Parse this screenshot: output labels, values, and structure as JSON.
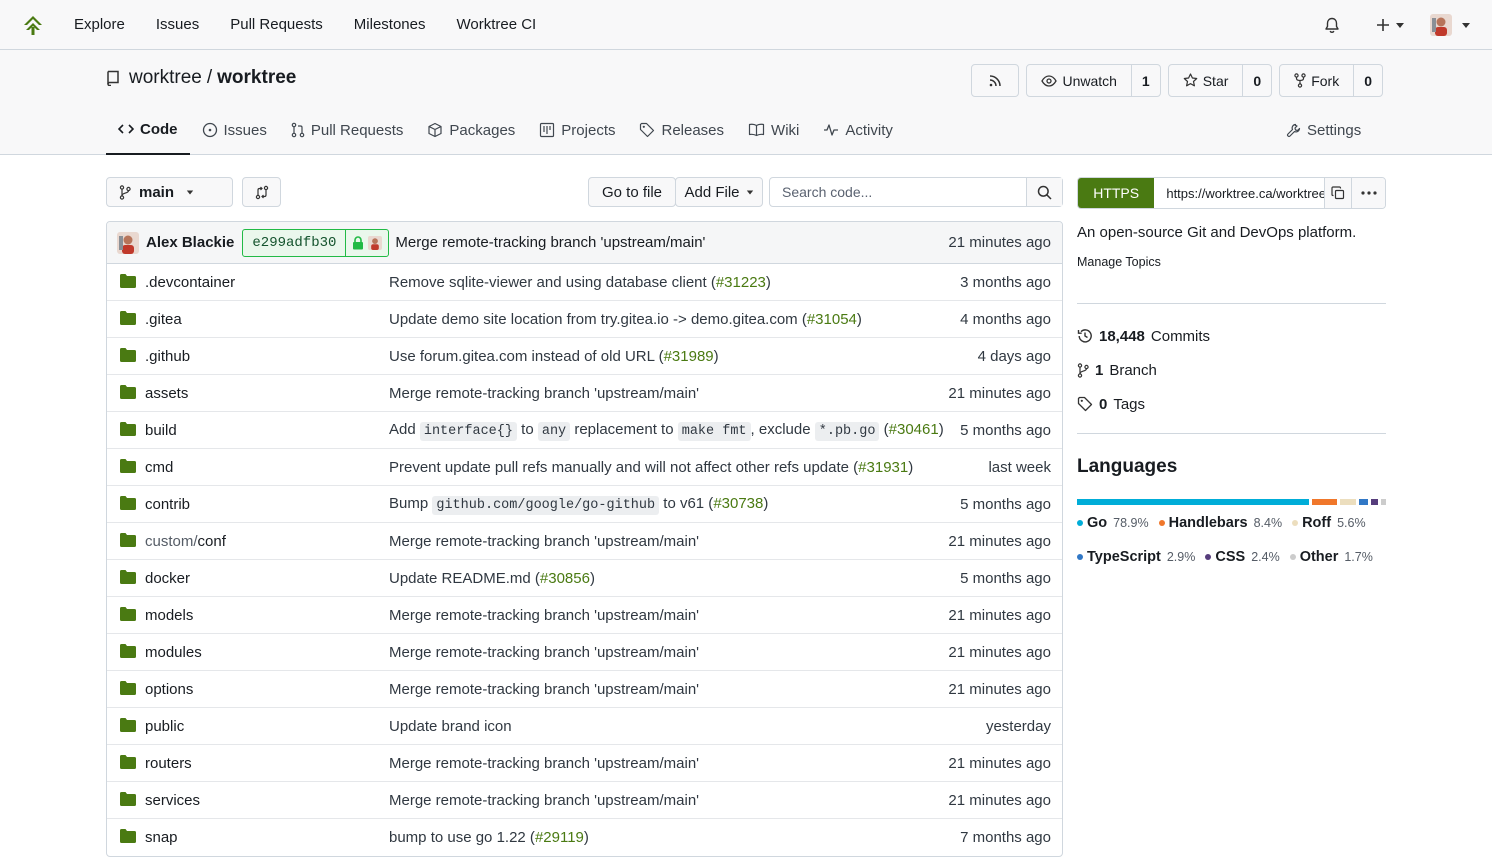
{
  "nav": {
    "items": [
      "Explore",
      "Issues",
      "Pull Requests",
      "Milestones",
      "Worktree CI"
    ]
  },
  "repo": {
    "owner": "worktree",
    "separator": "/",
    "name": "worktree",
    "watch_label": "Unwatch",
    "watch_count": "1",
    "star_label": "Star",
    "star_count": "0",
    "fork_label": "Fork",
    "fork_count": "0"
  },
  "tabs": [
    {
      "label": "Code",
      "icon": "code-icon"
    },
    {
      "label": "Issues",
      "icon": "issue-icon"
    },
    {
      "label": "Pull Requests",
      "icon": "pull-request-icon"
    },
    {
      "label": "Packages",
      "icon": "package-icon"
    },
    {
      "label": "Projects",
      "icon": "project-icon"
    },
    {
      "label": "Releases",
      "icon": "tag-icon"
    },
    {
      "label": "Wiki",
      "icon": "book-icon"
    },
    {
      "label": "Activity",
      "icon": "pulse-icon"
    }
  ],
  "settings_label": "Settings",
  "toolbar": {
    "branch": "main",
    "goto_file": "Go to file",
    "add_file": "Add File",
    "search_placeholder": "Search code..."
  },
  "latest_commit": {
    "author": "Alex Blackie",
    "sha": "e299adfb30",
    "message": "Merge remote-tracking branch 'upstream/main'",
    "time": "21 minutes ago"
  },
  "files": [
    {
      "name": ".devcontainer",
      "msg": [
        {
          "t": "Remove sqlite-viewer and using database client ("
        },
        {
          "t": "#31223",
          "k": "pr"
        },
        {
          "t": ")"
        }
      ],
      "time": "3 months ago"
    },
    {
      "name": ".gitea",
      "msg": [
        {
          "t": "Update demo site location from try.gitea.io -> demo.gitea.com ("
        },
        {
          "t": "#31054",
          "k": "pr"
        },
        {
          "t": ")"
        }
      ],
      "time": "4 months ago"
    },
    {
      "name": ".github",
      "msg": [
        {
          "t": "Use forum.gitea.com instead of old URL ("
        },
        {
          "t": "#31989",
          "k": "pr"
        },
        {
          "t": ")"
        }
      ],
      "time": "4 days ago"
    },
    {
      "name": "assets",
      "msg": [
        {
          "t": "Merge remote-tracking branch 'upstream/main'"
        }
      ],
      "time": "21 minutes ago"
    },
    {
      "name": "build",
      "msg": [
        {
          "t": "Add "
        },
        {
          "t": "interface{}",
          "k": "code"
        },
        {
          "t": " to "
        },
        {
          "t": "any",
          "k": "code"
        },
        {
          "t": " replacement to "
        },
        {
          "t": "make fmt",
          "k": "code"
        },
        {
          "t": ", exclude "
        },
        {
          "t": "*.pb.go",
          "k": "code"
        },
        {
          "t": " ("
        },
        {
          "t": "#30461",
          "k": "pr"
        },
        {
          "t": ")"
        }
      ],
      "time": "5 months ago"
    },
    {
      "name": "cmd",
      "msg": [
        {
          "t": "Prevent update pull refs manually and will not affect other refs update ("
        },
        {
          "t": "#31931",
          "k": "pr"
        },
        {
          "t": ")"
        }
      ],
      "time": "last week"
    },
    {
      "name": "contrib",
      "msg": [
        {
          "t": "Bump "
        },
        {
          "t": "github.com/google/go-github",
          "k": "code"
        },
        {
          "t": " to v61 ("
        },
        {
          "t": "#30738",
          "k": "pr"
        },
        {
          "t": ")"
        }
      ],
      "time": "5 months ago"
    },
    {
      "name_dim": "custom/",
      "name": "conf",
      "msg": [
        {
          "t": "Merge remote-tracking branch 'upstream/main'"
        }
      ],
      "time": "21 minutes ago"
    },
    {
      "name": "docker",
      "msg": [
        {
          "t": "Update README.md ("
        },
        {
          "t": "#30856",
          "k": "pr"
        },
        {
          "t": ")"
        }
      ],
      "time": "5 months ago"
    },
    {
      "name": "models",
      "msg": [
        {
          "t": "Merge remote-tracking branch 'upstream/main'"
        }
      ],
      "time": "21 minutes ago"
    },
    {
      "name": "modules",
      "msg": [
        {
          "t": "Merge remote-tracking branch 'upstream/main'"
        }
      ],
      "time": "21 minutes ago"
    },
    {
      "name": "options",
      "msg": [
        {
          "t": "Merge remote-tracking branch 'upstream/main'"
        }
      ],
      "time": "21 minutes ago"
    },
    {
      "name": "public",
      "msg": [
        {
          "t": "Update brand icon"
        }
      ],
      "time": "yesterday"
    },
    {
      "name": "routers",
      "msg": [
        {
          "t": "Merge remote-tracking branch 'upstream/main'"
        }
      ],
      "time": "21 minutes ago"
    },
    {
      "name": "services",
      "msg": [
        {
          "t": "Merge remote-tracking branch 'upstream/main'"
        }
      ],
      "time": "21 minutes ago"
    },
    {
      "name": "snap",
      "msg": [
        {
          "t": "bump to use go 1.22 ("
        },
        {
          "t": "#29119",
          "k": "pr"
        },
        {
          "t": ")"
        }
      ],
      "time": "7 months ago"
    }
  ],
  "sidebar": {
    "clone_protocol": "HTTPS",
    "clone_url": "https://worktree.ca/worktree/worktree.git",
    "description": "An open-source Git and DevOps platform.",
    "manage_topics": "Manage Topics",
    "commits_count": "18,448",
    "commits_label": "Commits",
    "branch_count": "1",
    "branch_label": "Branch",
    "tags_count": "0",
    "tags_label": "Tags",
    "languages_heading": "Languages",
    "languages": [
      {
        "name": "Go",
        "percent": "78.9%",
        "value": 78.9,
        "color": "#00add8"
      },
      {
        "name": "Handlebars",
        "percent": "8.4%",
        "value": 8.4,
        "color": "#f0772b"
      },
      {
        "name": "Roff",
        "percent": "5.6%",
        "value": 5.6,
        "color": "#ecdebe"
      },
      {
        "name": "TypeScript",
        "percent": "2.9%",
        "value": 2.9,
        "color": "#3178c6"
      },
      {
        "name": "CSS",
        "percent": "2.4%",
        "value": 2.4,
        "color": "#563d7c"
      },
      {
        "name": "Other",
        "percent": "1.7%",
        "value": 1.7,
        "color": "#cccccc"
      }
    ]
  },
  "colors": {
    "accent": "#4a7a12",
    "folder": "#4a7a12"
  }
}
